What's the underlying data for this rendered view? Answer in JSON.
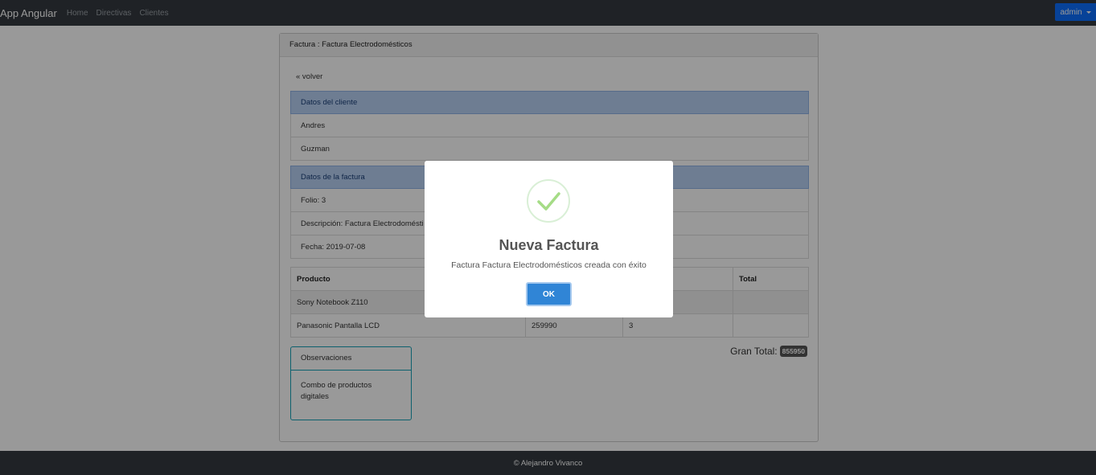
{
  "navbar": {
    "brand": "App Angular",
    "links": [
      "Home",
      "Directivas",
      "Clientes"
    ],
    "user": "admin"
  },
  "card": {
    "header": "Factura : Factura Electrodomésticos",
    "back_link": "« volver",
    "cliente": {
      "heading": "Datos del cliente",
      "nombre": "Andres",
      "apellido": "Guzman"
    },
    "factura": {
      "heading": "Datos de la factura",
      "folio": "Folio: 3",
      "descripcion": "Descripción: Factura Electrodomésti",
      "fecha": "Fecha: 2019-07-08"
    },
    "table": {
      "headers": [
        "Producto",
        "",
        "",
        "Total"
      ],
      "rows": [
        [
          "Sony Notebook Z110",
          "",
          "",
          ""
        ],
        [
          "Panasonic Pantalla LCD",
          "259990",
          "3",
          ""
        ]
      ]
    },
    "gran_total": {
      "label": "Gran Total:",
      "value": "855950"
    },
    "observaciones": {
      "heading": "Observaciones",
      "text": "Combo de productos digitales"
    }
  },
  "footer": {
    "text": "© Alejandro Vivanco"
  },
  "modal": {
    "icon": "success-check-icon",
    "title": "Nueva Factura",
    "message": "Factura Factura Electrodomésticos creada con éxito",
    "ok_label": "OK"
  },
  "colors": {
    "navbar_bg": "#343a40",
    "accent": "#0d6efd",
    "list_head_bg": "#b8d1f3",
    "ok_button": "#3085d6",
    "success": "#a5dc86"
  }
}
